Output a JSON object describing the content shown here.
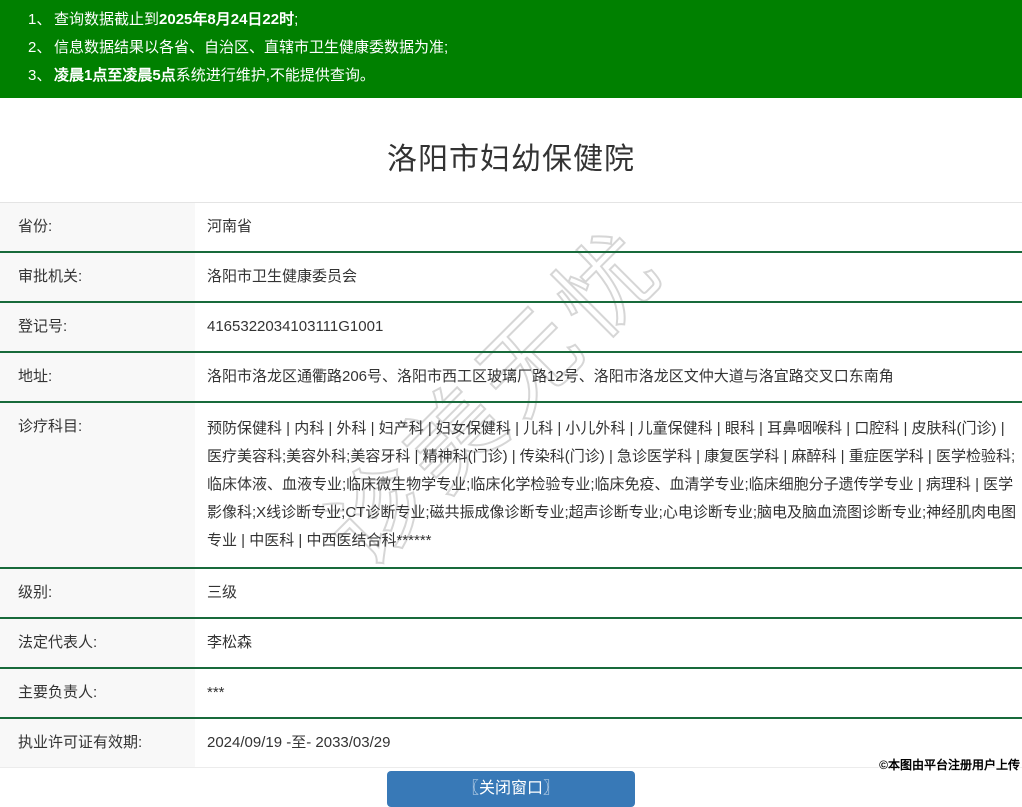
{
  "banner": {
    "lines": [
      {
        "num": "1、",
        "pre": "查询数据截止到",
        "bold": "2025年8月24日22时",
        "post": ";"
      },
      {
        "num": "2、",
        "pre": "信息数据结果以各省、自治区、直辖市卫生健康委数据为准;",
        "bold": "",
        "post": ""
      },
      {
        "num": "3、",
        "pre": "",
        "bold": "凌晨1点至凌晨5点",
        "post": "系统进行维护,不能提供查询。"
      }
    ]
  },
  "title": "洛阳市妇幼保健院",
  "table": {
    "rows": [
      {
        "label": "省份:",
        "value": "河南省"
      },
      {
        "label": "审批机关:",
        "value": "洛阳市卫生健康委员会"
      },
      {
        "label": "登记号:",
        "value": "4165322034103111G1001"
      },
      {
        "label": "地址:",
        "value": "洛阳市洛龙区通衢路206号、洛阳市西工区玻璃厂路12号、洛阳市洛龙区文仲大道与洛宜路交叉口东南角"
      },
      {
        "label": "诊疗科目:",
        "value": "预防保健科 | 内科 | 外科 | 妇产科 | 妇女保健科 | 儿科 | 小儿外科 | 儿童保健科 | 眼科 | 耳鼻咽喉科 | 口腔科 | 皮肤科(门诊) | 医疗美容科;美容外科;美容牙科 | 精神科(门诊) | 传染科(门诊) | 急诊医学科 | 康复医学科 | 麻醉科 | 重症医学科 | 医学检验科;临床体液、血液专业;临床微生物学专业;临床化学检验专业;临床免疫、血清学专业;临床细胞分子遗传学专业 | 病理科 | 医学影像科;X线诊断专业;CT诊断专业;磁共振成像诊断专业;超声诊断专业;心电诊断专业;脑电及脑血流图诊断专业;神经肌肉电图专业 | 中医科 | 中西医结合科******"
      },
      {
        "label": "级别:",
        "value": "三级"
      },
      {
        "label": "法定代表人:",
        "value": "李松森"
      },
      {
        "label": "主要负责人:",
        "value": "***"
      },
      {
        "label": "执业许可证有效期:",
        "value": "2024/09/19 -至- 2033/03/29"
      }
    ]
  },
  "footer": {
    "close_button_label": "〖关闭窗口〗",
    "copyright": "©本图由平台注册用户上传"
  },
  "watermark_text": "诊美无忧",
  "colors": {
    "banner_green": "#008000",
    "row_divider_green": "#186a3b",
    "label_cell_bg": "#f8f8f8",
    "button_blue": "#3879b7",
    "text": "#333333"
  }
}
